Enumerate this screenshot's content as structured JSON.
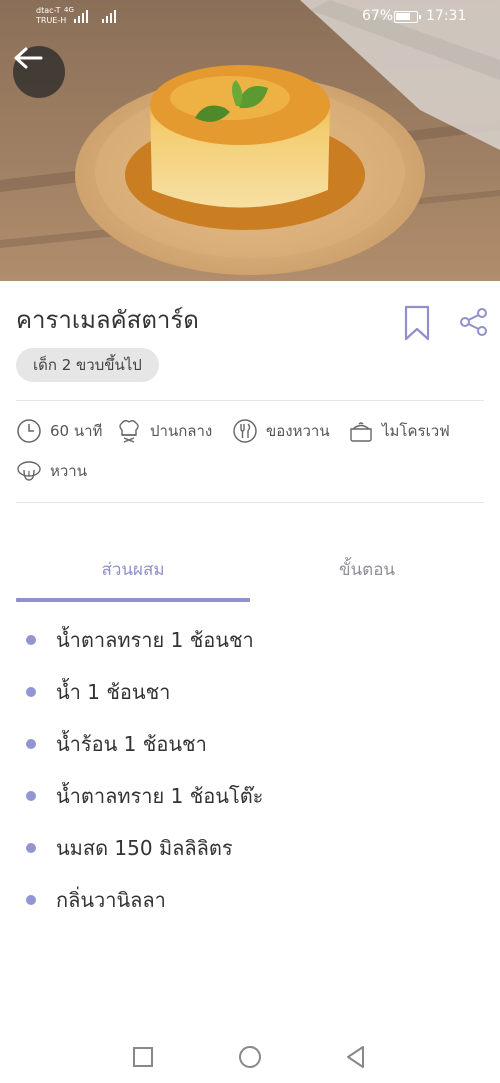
{
  "status_bar": {
    "carrier_1": "dtac-T",
    "carrier_2": "TRUE-H",
    "network": "4G",
    "battery_percent": "67%",
    "battery_level": 0.67,
    "time": "17:31"
  },
  "hero": {
    "image": "caramel-custard-photo"
  },
  "recipe": {
    "title": "คาราเมลคัสตาร์ด",
    "age_tag": "เด็ก 2 ขวบขึ้นไป",
    "meta": [
      {
        "icon": "clock-icon",
        "label": "60 นาที"
      },
      {
        "icon": "chef-hat-icon",
        "label": "ปานกลาง"
      },
      {
        "icon": "cutlery-icon",
        "label": "ของหวาน"
      },
      {
        "icon": "pot-icon",
        "label": "ไมโครเวฟ"
      },
      {
        "icon": "tongue-icon",
        "label": "หวาน"
      }
    ]
  },
  "tabs": [
    {
      "label": "ส่วนผสม",
      "active": true
    },
    {
      "label": "ขั้นตอน",
      "active": false
    }
  ],
  "ingredients": [
    "น้ำตาลทราย 1 ช้อนชา",
    "น้ำ 1 ช้อนชา",
    "น้ำร้อน 1 ช้อนชา",
    "น้ำตาลทราย 1 ช้อนโต๊ะ",
    "นมสด 150 มิลลิลิตร",
    "กลิ่นวานิลลา"
  ],
  "colors": {
    "accent": "#8f90cc",
    "bullet": "#9395d3",
    "chip_bg": "#e6e6e6"
  }
}
